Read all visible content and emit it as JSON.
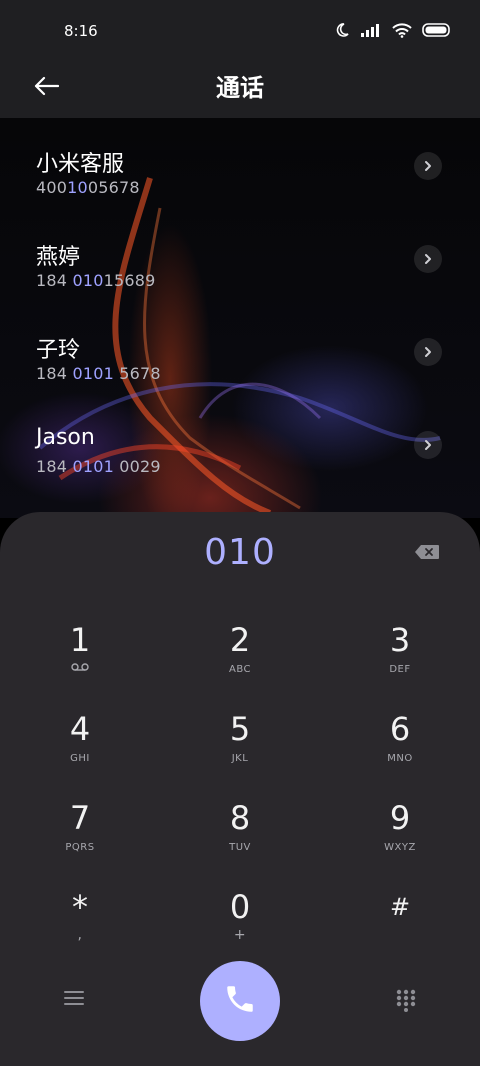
{
  "status_bar": {
    "time": "8:16",
    "icons": [
      "moon-icon",
      "signal-icon",
      "wifi-icon",
      "battery-icon"
    ]
  },
  "header": {
    "title": "通话",
    "back_icon": "back-arrow-icon"
  },
  "contacts": [
    {
      "name": "小米客服",
      "number_pre": "400",
      "number_match": "10",
      "number_post": "05678"
    },
    {
      "name": "燕婷",
      "number_pre": "184 ",
      "number_match": "010",
      "number_post": "15689"
    },
    {
      "name": "子玲",
      "number_pre": "184 ",
      "number_match": "0101",
      "number_post": " 5678"
    },
    {
      "name": "Jason",
      "number_pre": "184 ",
      "number_match": "0101",
      "number_post": " 0029"
    }
  ],
  "dialpad": {
    "input": "010",
    "keys": [
      {
        "digit": "1",
        "letters": ""
      },
      {
        "digit": "2",
        "letters": "ABC"
      },
      {
        "digit": "3",
        "letters": "DEF"
      },
      {
        "digit": "4",
        "letters": "GHI"
      },
      {
        "digit": "5",
        "letters": "JKL"
      },
      {
        "digit": "6",
        "letters": "MNO"
      },
      {
        "digit": "7",
        "letters": "PQRS"
      },
      {
        "digit": "8",
        "letters": "TUV"
      },
      {
        "digit": "9",
        "letters": "WXYZ"
      },
      {
        "digit": "*",
        "letters": ","
      },
      {
        "digit": "0",
        "letters": "+"
      },
      {
        "digit": "#",
        "letters": ""
      }
    ]
  },
  "colors": {
    "accent": "#aeb0ff",
    "panel": "#2a282c",
    "header": "#1f1f22"
  }
}
